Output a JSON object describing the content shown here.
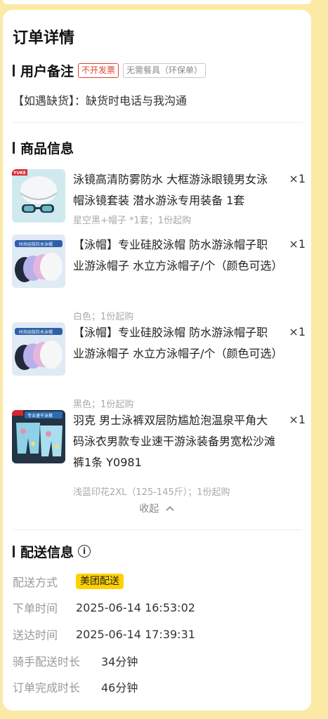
{
  "card_title": "订单详情",
  "remark_section": {
    "title": "用户备注",
    "tag_invoice": "不开发票",
    "tag_tableware": "无需餐具（环保单）",
    "remark": "【如遇缺货】：缺货时电话与我沟通"
  },
  "product_section": {
    "title": "商品信息",
    "items": [
      {
        "name": "泳镜高清防雾防水 大框游泳眼镜男女泳帽泳镜套装 潜水游泳专用装备 1套",
        "qty": "×1",
        "spec": "星空黑+帽子 *1套；1份起购",
        "thumb_label": "YUKE",
        "thumb_icon": "swim-goggles-cap-image"
      },
      {
        "name": "【泳帽】专业硅胶泳帽 防水游泳帽子职业游泳帽子 水立方泳帽子/个（颜色可选）",
        "qty": "×1",
        "spec": "白色；1份起购",
        "thumb_label": "时尚硅胶防水泳帽",
        "thumb_icon": "swim-cap-image"
      },
      {
        "name": "【泳帽】专业硅胶泳帽 防水游泳帽子职业游泳帽子 水立方泳帽子/个（颜色可选）",
        "qty": "×1",
        "spec": "黑色；1份起购",
        "thumb_label": "时尚硅胶防水泳帽",
        "thumb_icon": "swim-cap-image"
      },
      {
        "name": "羽克 男士泳裤双层防尴尬泡温泉平角大码泳衣男款专业速干游泳装备男宽松沙滩裤1条 Y0981",
        "qty": "×1",
        "spec": "浅蓝印花2XL（125-145斤）；1份起购",
        "thumb_label": "专业速干泳裤",
        "thumb_icon": "swim-shorts-image"
      }
    ],
    "collapse_label": "收起",
    "collapse_icon": "chevron-up-icon"
  },
  "delivery_section": {
    "title": "配送信息",
    "info_icon": "info-icon",
    "method_label": "配送方式",
    "method_value": "美团配送",
    "order_time_label": "下单时间",
    "order_time_value": "2025-06-14 16:53:02",
    "arrive_time_label": "送达时间",
    "arrive_time_value": "2025-06-14 17:39:31",
    "rider_duration_label": "骑手配送时长",
    "rider_duration_value": "34分钟",
    "complete_duration_label": "订单完成时长",
    "complete_duration_value": "46分钟"
  },
  "colors": {
    "page_bg": "#fbe9a6",
    "badge_yellow": "#ffd100",
    "tag_red": "#e1442e"
  }
}
